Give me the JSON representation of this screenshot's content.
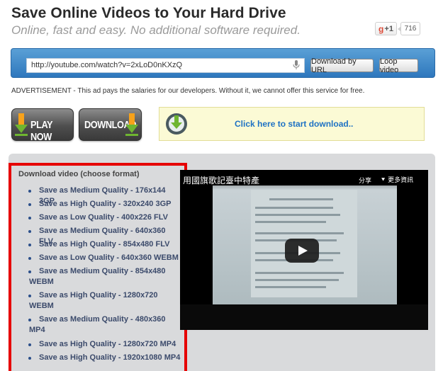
{
  "header": {
    "title": "Save Online Videos to Your Hard Drive",
    "subtitle": "Online, fast and easy. No additional software required.",
    "gplus_g": "g",
    "gplus_label": "+1",
    "gplus_count": "716"
  },
  "urlbar": {
    "url_value": "http://youtube.com/watch?v=2xLoD0nKXzQ",
    "download_url_label": "Download by URL",
    "loop_label": "Loop video"
  },
  "advertisement": "ADVERTISEMENT - This ad pays the salaries for our developers. Without it, we cannot offer this service for free.",
  "buttons": {
    "play_now": "PLAY NOW",
    "download": "DOWNLOAD",
    "start_download": "Click here to start download.."
  },
  "download_list": {
    "heading": "Download video (choose format)",
    "items": [
      "Save as Medium Quality - 176x144 3GP",
      "Save as High Quality - 320x240 3GP",
      "Save as Low Quality - 400x226 FLV",
      "Save as Medium Quality - 640x360 FLV",
      "Save as High Quality - 854x480 FLV",
      "Save as Low Quality - 640x360 WEBM",
      "Save as Medium Quality - 854x480 WEBM",
      "Save as High Quality - 1280x720 WEBM",
      "Save as Medium Quality - 480x360 MP4",
      "Save as High Quality - 1280x720 MP4",
      "Save as High Quality - 1920x1080 MP4"
    ]
  },
  "video": {
    "title": "用國旗歌記臺中特產",
    "share": "分享",
    "more": "更多資訊"
  },
  "colors": {
    "link": "#1f72c4",
    "urlbar": "#3a82c4",
    "highlight_border": "#e60000",
    "panel": "#d9dadc"
  }
}
